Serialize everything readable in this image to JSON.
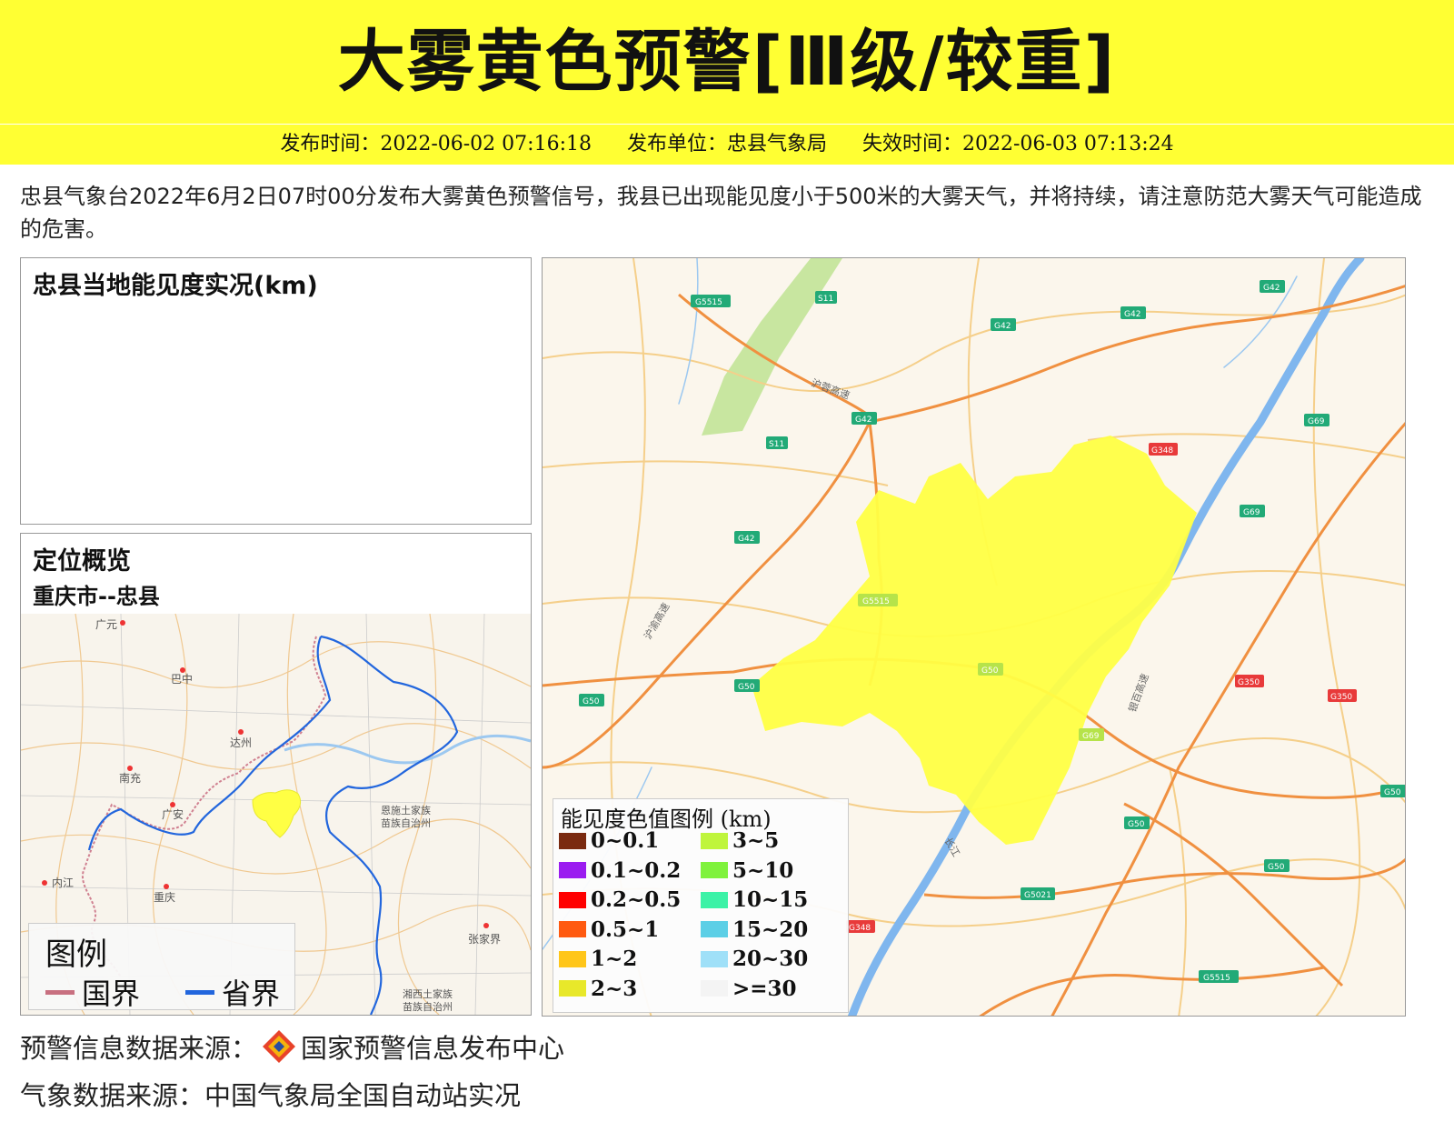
{
  "banner": {
    "title": "大雾黄色预警[Ⅲ级/较重]",
    "color": "#ffff33"
  },
  "meta": {
    "publish_time": "发布时间：2022-06-02 07:16:18",
    "publisher": "发布单位：忠县气象局",
    "expire_time": "失效时间：2022-06-03 07:13:24"
  },
  "description": "忠县气象台2022年6月2日07时00分发布大雾黄色预警信号，我县已出现能见度小于500米的大雾天气，并将持续，请注意防范大雾天气可能造成的危害。",
  "visibility_panel": {
    "title": "忠县当地能见度实况(km)"
  },
  "location_panel": {
    "title": "定位概览",
    "subtitle": "重庆市--忠县",
    "cities": [
      "广元",
      "巴中",
      "达州",
      "南充",
      "广安",
      "内江",
      "重庆",
      "恩施土家族苗族自治州",
      "张家界",
      "湘西土家族苗族自治州"
    ],
    "legend": {
      "title": "图例",
      "items": [
        {
          "label": "国界",
          "color": "#c87080"
        },
        {
          "label": "省界",
          "color": "#2266dd"
        }
      ]
    }
  },
  "main_map": {
    "highlight_color": "#ffff44",
    "road_labels": [
      "G5515",
      "S11",
      "G42",
      "G42",
      "G42",
      "G42",
      "S11",
      "G42",
      "G348",
      "G69",
      "G69",
      "G5515",
      "G50",
      "G50",
      "G50",
      "G69",
      "G350",
      "G350",
      "G50",
      "G50",
      "G50",
      "G5021",
      "G348",
      "G5515"
    ],
    "place_labels": [
      "沪蓉高速",
      "沪渝高速",
      "银百高速",
      "长江"
    ]
  },
  "visibility_legend": {
    "title": "能见度色值图例 (km)",
    "items": [
      {
        "label": "0~0.1",
        "color": "#7a2a10"
      },
      {
        "label": "0.1~0.2",
        "color": "#9b1cf0"
      },
      {
        "label": "0.2~0.5",
        "color": "#ff0000"
      },
      {
        "label": "0.5~1",
        "color": "#ff5a10"
      },
      {
        "label": "1~2",
        "color": "#ffc61a"
      },
      {
        "label": "2~3",
        "color": "#e8e82a"
      },
      {
        "label": "3~5",
        "color": "#bff53c"
      },
      {
        "label": "5~10",
        "color": "#7ff23c"
      },
      {
        "label": "10~15",
        "color": "#3cf2a6"
      },
      {
        "label": "15~20",
        "color": "#5ccfe6"
      },
      {
        "label": "20~30",
        "color": "#9fe0f8"
      },
      {
        "label": ">=30",
        "color": "#f4f4f4"
      }
    ]
  },
  "sources": {
    "warning_prefix": "预警信息数据来源：",
    "warning_org": "国家预警信息发布中心",
    "weather": "气象数据来源：中国气象局全国自动站实况"
  }
}
